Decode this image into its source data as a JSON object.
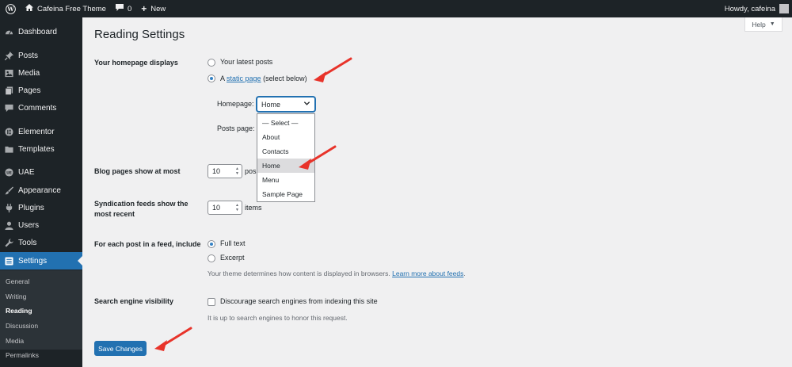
{
  "admin_bar": {
    "site_name": "Cafeina Free Theme",
    "comments_count": "0",
    "new_label": "New",
    "howdy": "Howdy, cafeina"
  },
  "sidebar": {
    "items": [
      {
        "label": "Dashboard",
        "icon": "dashboard-icon"
      },
      {
        "label": "Posts",
        "icon": "pin-icon"
      },
      {
        "label": "Media",
        "icon": "media-icon"
      },
      {
        "label": "Pages",
        "icon": "pages-icon"
      },
      {
        "label": "Comments",
        "icon": "comments-icon"
      },
      {
        "label": "Elementor",
        "icon": "elementor-icon"
      },
      {
        "label": "Templates",
        "icon": "folder-icon"
      },
      {
        "label": "UAE",
        "icon": "uae-icon"
      },
      {
        "label": "Appearance",
        "icon": "brush-icon"
      },
      {
        "label": "Plugins",
        "icon": "plug-icon"
      },
      {
        "label": "Users",
        "icon": "user-icon"
      },
      {
        "label": "Tools",
        "icon": "wrench-icon"
      },
      {
        "label": "Settings",
        "icon": "settings-icon"
      }
    ],
    "submenu": [
      "General",
      "Writing",
      "Reading",
      "Discussion",
      "Media",
      "Permalinks"
    ]
  },
  "page": {
    "title": "Reading Settings",
    "help_label": "Help"
  },
  "homepage_displays": {
    "label": "Your homepage displays",
    "option_latest": "Your latest posts",
    "option_static_prefix": "A",
    "option_static_link": "static page",
    "option_static_suffix": "(select below)",
    "homepage_label": "Homepage:",
    "homepage_value": "Home",
    "posts_page_label": "Posts page:",
    "dropdown_options": [
      "— Select —",
      "About",
      "Contacts",
      "Home",
      "Menu",
      "Sample Page"
    ]
  },
  "blog_pages": {
    "label": "Blog pages show at most",
    "value": "10",
    "unit": "pos"
  },
  "syndication": {
    "label": "Syndication feeds show the most recent",
    "value": "10",
    "unit": "items"
  },
  "feed_include": {
    "label": "For each post in a feed, include",
    "option_full": "Full text",
    "option_excerpt": "Excerpt",
    "desc": "Your theme determines how content is displayed in browsers.",
    "desc_link": "Learn more about feeds",
    "desc_end": "."
  },
  "search_visibility": {
    "label": "Search engine visibility",
    "checkbox_label": "Discourage search engines from indexing this site",
    "desc": "It is up to search engines to honor this request."
  },
  "save_label": "Save Changes",
  "colors": {
    "admin_dark": "#1d2327",
    "accent": "#2271b1",
    "arrow": "#e8332a"
  }
}
